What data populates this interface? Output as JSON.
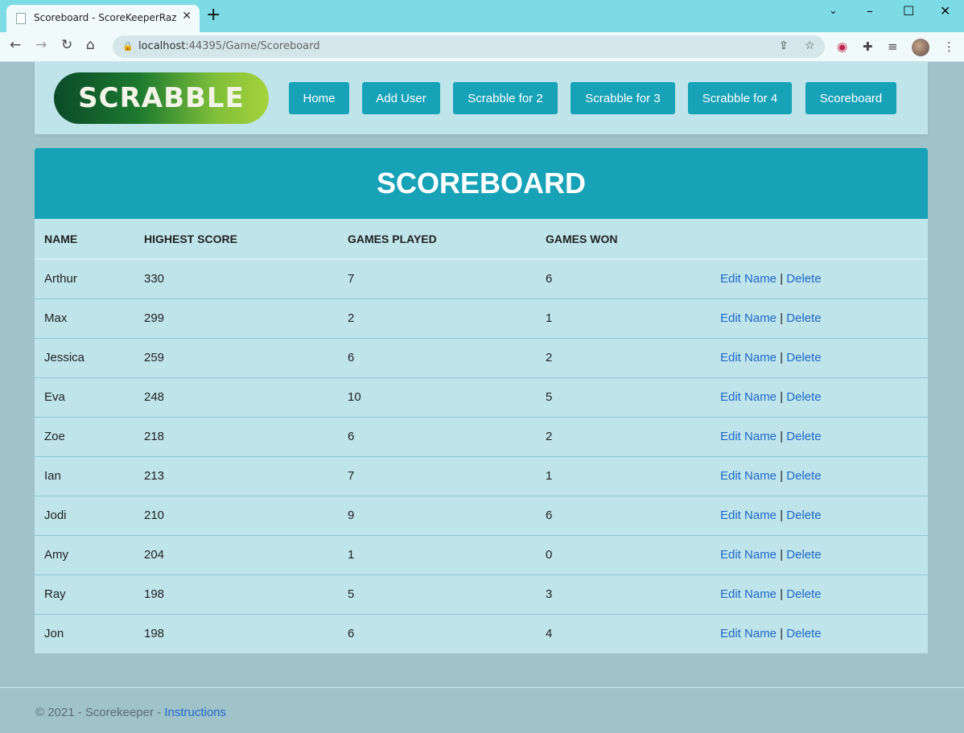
{
  "browser": {
    "tab_title": "Scoreboard - ScoreKeeperRazorP",
    "url_host": "localhost",
    "url_rest": ":44395/Game/Scoreboard"
  },
  "site": {
    "logo_text": "SCRABBLE",
    "nav": [
      "Home",
      "Add User",
      "Scrabble for 2",
      "Scrabble for 3",
      "Scrabble for 4",
      "Scoreboard"
    ]
  },
  "page": {
    "title": "SCOREBOARD"
  },
  "table": {
    "headers": [
      "NAME",
      "HIGHEST SCORE",
      "GAMES PLAYED",
      "GAMES WON"
    ],
    "edit_label": "Edit Name",
    "delete_label": "Delete",
    "separator": "|",
    "rows": [
      [
        "Arthur",
        "330",
        "7",
        "6"
      ],
      [
        "Max",
        "299",
        "2",
        "1"
      ],
      [
        "Jessica",
        "259",
        "6",
        "2"
      ],
      [
        "Eva",
        "248",
        "10",
        "5"
      ],
      [
        "Zoe",
        "218",
        "6",
        "2"
      ],
      [
        "Ian",
        "213",
        "7",
        "1"
      ],
      [
        "Jodi",
        "210",
        "9",
        "6"
      ],
      [
        "Amy",
        "204",
        "1",
        "0"
      ],
      [
        "Ray",
        "198",
        "5",
        "3"
      ],
      [
        "Jon",
        "198",
        "6",
        "4"
      ]
    ]
  },
  "footer": {
    "text": "© 2021 - Scorekeeper - ",
    "link": "Instructions"
  },
  "colors": {
    "accent": "#17a2b8",
    "panel": "#bfe4ea",
    "background": "#a0c3ca",
    "link": "#1f67c8"
  }
}
